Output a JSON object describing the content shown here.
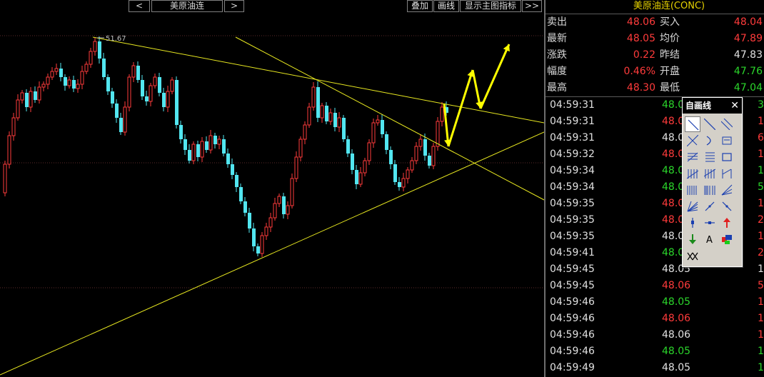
{
  "toolbar": {
    "prev": "<",
    "symbol": "美原油连",
    "next": ">",
    "overlay": "叠加",
    "draw": "画线",
    "main_indicator": "显示主图指标",
    "more": ">>"
  },
  "chart": {
    "high_label": "51.67"
  },
  "quote": {
    "title": "美原油连(CONC)",
    "rows": [
      {
        "l1": "卖出",
        "v1": "48.06",
        "c1": "red",
        "l2": "买入",
        "v2": "48.04",
        "c2": "red"
      },
      {
        "l1": "最新",
        "v1": "48.05",
        "c1": "red",
        "l2": "均价",
        "v2": "47.89",
        "c2": "red"
      },
      {
        "l1": "涨跌",
        "v1": "0.22",
        "c1": "red",
        "l2": "昨结",
        "v2": "47.83",
        "c2": "white"
      },
      {
        "l1": "幅度",
        "v1": "0.46%",
        "c1": "red",
        "l2": "开盘",
        "v2": "47.76",
        "c2": "green"
      },
      {
        "l1": "最高",
        "v1": "48.30",
        "c1": "red",
        "l2": "最低",
        "v2": "47.04",
        "c2": "green"
      }
    ]
  },
  "ticks": [
    {
      "time": "04:59:31",
      "price": "48.05",
      "pc": "green",
      "vol": "3",
      "vc": "green"
    },
    {
      "time": "04:59:31",
      "price": "48.06",
      "pc": "red",
      "vol": "1",
      "vc": "red"
    },
    {
      "time": "04:59:31",
      "price": "48.05",
      "pc": "white",
      "vol": "6",
      "vc": "red"
    },
    {
      "time": "04:59:32",
      "price": "48.06",
      "pc": "red",
      "vol": "1",
      "vc": "red"
    },
    {
      "time": "04:59:34",
      "price": "48.05",
      "pc": "green",
      "vol": "1",
      "vc": "green"
    },
    {
      "time": "04:59:34",
      "price": "48.05",
      "pc": "green",
      "vol": "5",
      "vc": "green"
    },
    {
      "time": "04:59:35",
      "price": "48.06",
      "pc": "red",
      "vol": "1",
      "vc": "red"
    },
    {
      "time": "04:59:35",
      "price": "48.06",
      "pc": "red",
      "vol": "2",
      "vc": "red"
    },
    {
      "time": "04:59:35",
      "price": "48.06",
      "pc": "white",
      "vol": "1",
      "vc": "red"
    },
    {
      "time": "04:59:41",
      "price": "48.05",
      "pc": "green",
      "vol": "2",
      "vc": "red"
    },
    {
      "time": "04:59:45",
      "price": "48.05",
      "pc": "white",
      "vol": "1",
      "vc": "white"
    },
    {
      "time": "04:59:45",
      "price": "48.06",
      "pc": "red",
      "vol": "5",
      "vc": "red"
    },
    {
      "time": "04:59:46",
      "price": "48.05",
      "pc": "green",
      "vol": "1",
      "vc": "red"
    },
    {
      "time": "04:59:46",
      "price": "48.06",
      "pc": "red",
      "vol": "1",
      "vc": "red"
    },
    {
      "time": "04:59:46",
      "price": "48.06",
      "pc": "white",
      "vol": "1",
      "vc": "red"
    },
    {
      "time": "04:59:46",
      "price": "48.05",
      "pc": "green",
      "vol": "1",
      "vc": "green"
    },
    {
      "time": "04:59:49",
      "price": "48.05",
      "pc": "white",
      "vol": "1",
      "vc": "green"
    }
  ],
  "palette": {
    "title": "自画线",
    "close": "✕",
    "tools": [
      "segment-icon",
      "line-icon",
      "parallel-lines-icon",
      "ray-icon",
      "arc-icon",
      "price-label-icon",
      "channel-icon",
      "gann-icon",
      "rectangle-icon",
      "fan-lines-icon",
      "triple-lines-icon",
      "range-icon",
      "cycle-lines-icon",
      "fibonacci-time-icon",
      "speed-lines-icon",
      "gann-fan-icon",
      "arrow-line-icon",
      "arrow-up-line-icon",
      "price-mark-icon",
      "horizontal-arrow-icon",
      "up-arrow-icon",
      "down-arrow-icon",
      "text-tool-icon",
      "color-icon",
      "delete-lines-icon"
    ],
    "text_glyph": "A"
  },
  "colors": {
    "up": "#ff3b3b",
    "down": "#52e6f0",
    "trendline": "#e8e820",
    "forecast": "#ffff00",
    "title": "#e6d200"
  }
}
